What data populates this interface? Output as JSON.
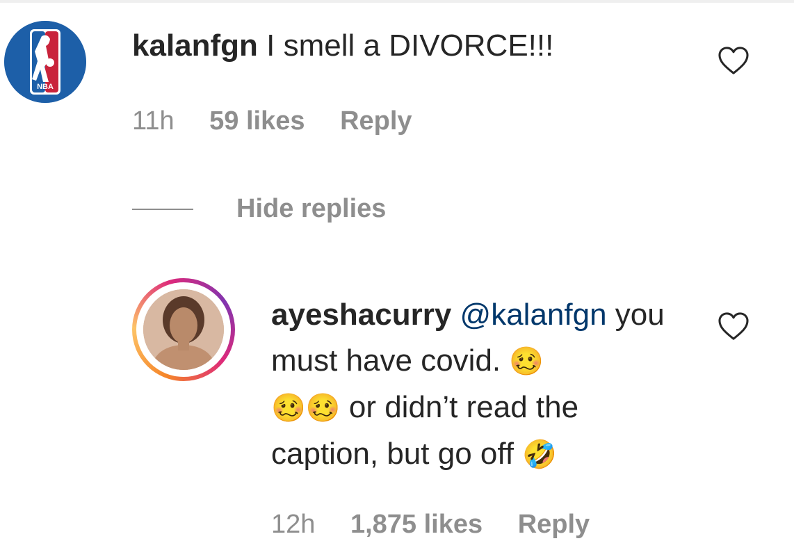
{
  "comment": {
    "username": "kalanfgn",
    "text": "I smell a DIVORCE!!!",
    "avatar_label": "NBA",
    "time": "11h",
    "likes": "59 likes",
    "reply_label": "Reply",
    "hide_replies_label": "Hide replies"
  },
  "reply": {
    "username": "ayeshacurry",
    "mention": "@kalanfgn",
    "line1": "you must have covid.",
    "emoji_woozy": "🥴",
    "line2": "or didn’t read the caption, but go off",
    "emoji_rofl": "🤣",
    "time": "12h",
    "likes": "1,875 likes",
    "reply_label": "Reply"
  },
  "colors": {
    "text": "#262626",
    "muted": "#8e8e8e",
    "mention": "#00376b",
    "nba_blue": "#1d5fa8",
    "nba_red": "#c9233b"
  },
  "icons": {
    "like": "heart-outline-icon",
    "nba": "nba-logo-icon"
  }
}
